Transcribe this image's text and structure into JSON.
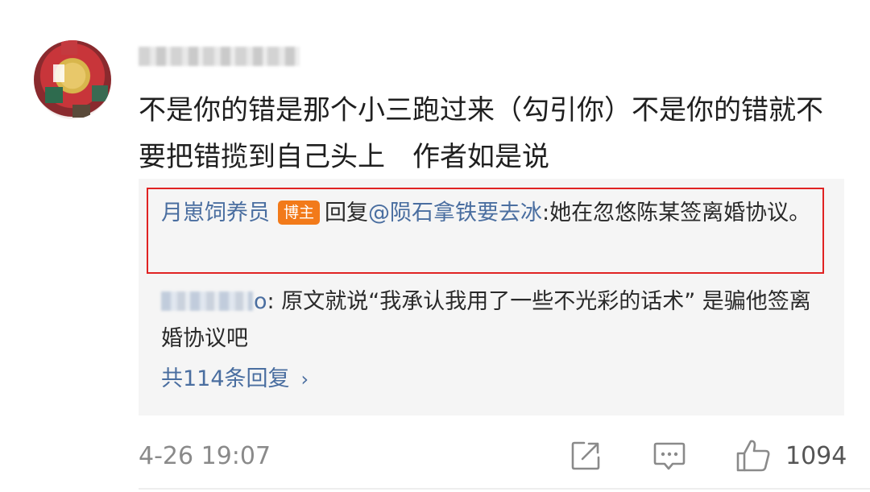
{
  "comment": {
    "text": "不是你的错是那个小三跑过来（勾引你）不是你的错就不要把错揽到自己头上　作者如是说",
    "timestamp": "4-26 19:07"
  },
  "replies": [
    {
      "author": "月崽饲养员",
      "badge": "博主",
      "reply_word": "回复",
      "mention": "@陨石拿铁要去冰",
      "content": ":她在忽悠陈某签离婚协议。"
    },
    {
      "author_visible": "o",
      "content": ": 原文就说“我承认我用了一些不光彩的话术” 是骗他签离婚协议吧"
    }
  ],
  "more_replies": {
    "label": "共114条回复",
    "chevron": "›"
  },
  "actions": {
    "share_icon": "share-icon",
    "comment_icon": "comment-icon",
    "like_icon": "thumbs-up-icon",
    "like_count": "1094"
  },
  "colors": {
    "link": "#4a6ea0",
    "badge": "#f27a1a",
    "highlight_border": "#e02323",
    "reply_bg": "#f5f5f5",
    "meta_gray": "#8a8a8a"
  }
}
